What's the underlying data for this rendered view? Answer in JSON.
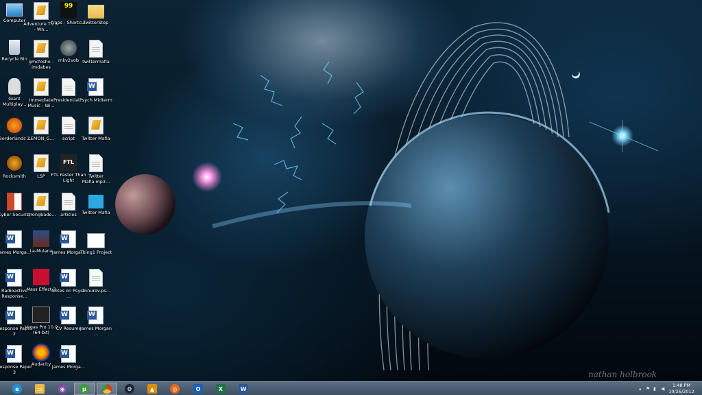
{
  "desktop": {
    "icons": [
      {
        "label": "Computer",
        "kind": "computer"
      },
      {
        "label": "Recycle Bin",
        "kind": "recycle"
      },
      {
        "label": "Giant Multiplay...",
        "kind": "game-giant"
      },
      {
        "label": "Borderlands 2",
        "kind": "borderlands"
      },
      {
        "label": "Rocksmith",
        "kind": "rocksmith"
      },
      {
        "label": "Cyber Security",
        "kind": "powerpoint"
      },
      {
        "label": "James Morga...",
        "kind": "word"
      },
      {
        "label": "Radioactive Response...",
        "kind": "word"
      },
      {
        "label": "Response Paper 2",
        "kind": "word"
      },
      {
        "label": "Response Paper 3",
        "kind": "word"
      },
      {
        "label": "Adventure Time - Wh...",
        "kind": "shortcut"
      },
      {
        "label": "gmcfosho - imdabes",
        "kind": "shortcut"
      },
      {
        "label": "Immediate Music - Wi...",
        "kind": "shortcut"
      },
      {
        "label": "LEMON_G...",
        "kind": "shortcut"
      },
      {
        "label": "LSP",
        "kind": "shortcut"
      },
      {
        "label": "strongbade...",
        "kind": "shortcut"
      },
      {
        "label": "La-Mulana",
        "kind": "lamulana"
      },
      {
        "label": "Mass Effect 3",
        "kind": "masseffect"
      },
      {
        "label": "Vegas Pro 10.0 (64-bit)",
        "kind": "vegas"
      },
      {
        "label": "Audacity",
        "kind": "audacity"
      },
      {
        "label": "fraps - Shortcut",
        "kind": "fraps"
      },
      {
        "label": "mkv2vob",
        "kind": "mkv2vob"
      },
      {
        "label": "Presidential...",
        "kind": "doc"
      },
      {
        "label": "script",
        "kind": "doc"
      },
      {
        "label": "FTL Faster Than Light",
        "kind": "ftl"
      },
      {
        "label": "articles",
        "kind": "doc"
      },
      {
        "label": "James Morga...",
        "kind": "word"
      },
      {
        "label": "Notes on Psych ...",
        "kind": "word"
      },
      {
        "label": "CV Resume",
        "kind": "word"
      },
      {
        "label": "James Morga...",
        "kind": "word"
      },
      {
        "label": "TwitterStep",
        "kind": "folder"
      },
      {
        "label": "twittermafia",
        "kind": "doc"
      },
      {
        "label": "Psych Midterm",
        "kind": "word"
      },
      {
        "label": "Twitter Mafia",
        "kind": "shortcut"
      },
      {
        "label": "Twitter Mafia.mp3...",
        "kind": "doc"
      },
      {
        "label": "Twitter Mafia",
        "kind": "twitter"
      },
      {
        "label": "Thing1 Project",
        "kind": "folder-white"
      },
      {
        "label": "annurev.ps...",
        "kind": "doc-green"
      },
      {
        "label": "James Morgan ...",
        "kind": "word"
      }
    ]
  },
  "wallpaper": {
    "signature": "nathan holbrook"
  },
  "taskbar": {
    "apps": [
      {
        "name": "internet-explorer",
        "icon": "e",
        "color": "#1e90d6"
      },
      {
        "name": "file-explorer",
        "icon": "▭",
        "color": "#e8b94a"
      },
      {
        "name": "media-app",
        "icon": "◉",
        "color": "#7a4fa0"
      },
      {
        "name": "utorrent",
        "icon": "µ",
        "color": "#3a9b3a"
      },
      {
        "name": "chrome",
        "icon": "●",
        "color": "#d93b2b"
      },
      {
        "name": "steam",
        "icon": "⚙",
        "color": "#233"
      },
      {
        "name": "shortcut-app",
        "icon": "▲",
        "color": "#d98f12"
      },
      {
        "name": "firefox",
        "icon": "◎",
        "color": "#e66a1e"
      },
      {
        "name": "outlook",
        "icon": "O",
        "color": "#1f5fb4"
      },
      {
        "name": "excel",
        "icon": "X",
        "color": "#207245"
      },
      {
        "name": "word",
        "icon": "W",
        "color": "#2b5797"
      }
    ],
    "clock": {
      "time": "1:48 PM",
      "date": "10/26/2012"
    }
  }
}
